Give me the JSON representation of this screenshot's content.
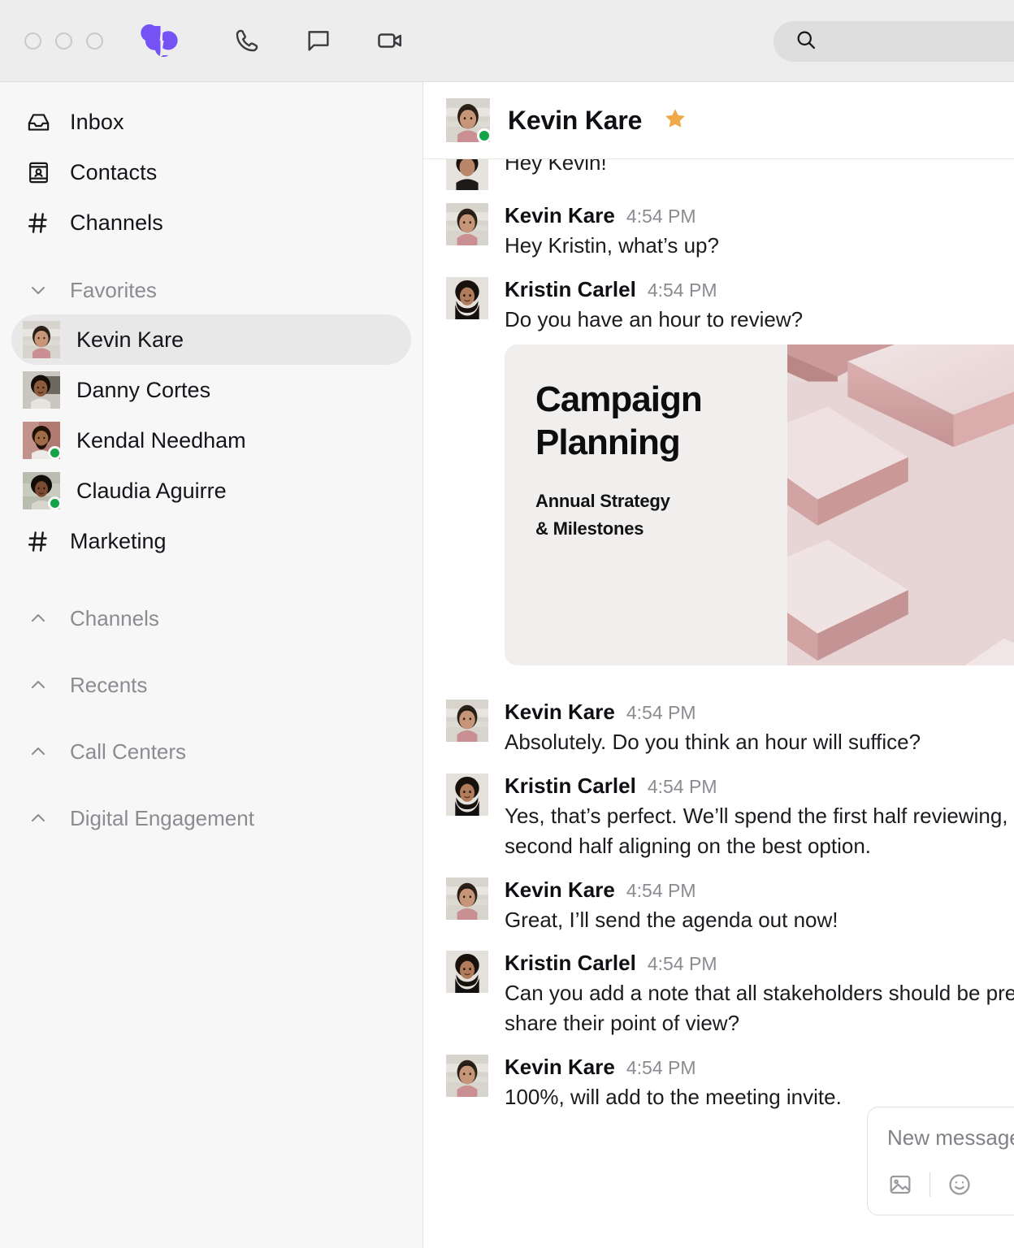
{
  "titlebar": {
    "window_controls": [
      "close",
      "minimize",
      "maximize"
    ],
    "logo_name": "dialpad-logo",
    "icons": [
      {
        "name": "phone-icon",
        "label": "Calls"
      },
      {
        "name": "chat-bubble-icon",
        "label": "Messages"
      },
      {
        "name": "video-camera-icon",
        "label": "Meetings"
      }
    ],
    "search": {
      "placeholder": "",
      "value": "",
      "icon": "search-icon"
    }
  },
  "sidebar": {
    "nav": [
      {
        "label": "Inbox",
        "icon": "inbox-icon"
      },
      {
        "label": "Contacts",
        "icon": "contacts-card-icon"
      },
      {
        "label": "Channels",
        "icon": "hash-icon"
      }
    ],
    "favorites": {
      "label": "Favorites",
      "expanded": true,
      "chevron": "chevron-down-icon",
      "items": [
        {
          "name": "Kevin Kare",
          "online": false,
          "selected": true
        },
        {
          "name": "Danny Cortes",
          "online": false,
          "selected": false
        },
        {
          "name": "Kendal Needham",
          "online": true,
          "selected": false
        },
        {
          "name": "Claudia Aguirre",
          "online": true,
          "selected": false
        }
      ],
      "channel": {
        "label": "Marketing",
        "icon": "hash-icon"
      }
    },
    "sections": [
      {
        "label": "Channels",
        "chevron": "chevron-up-icon",
        "expanded": false
      },
      {
        "label": "Recents",
        "chevron": "chevron-up-icon",
        "expanded": false
      },
      {
        "label": "Call Centers",
        "chevron": "chevron-up-icon",
        "expanded": false
      },
      {
        "label": "Digital Engagement",
        "chevron": "chevron-up-icon",
        "expanded": false
      }
    ]
  },
  "chat": {
    "header": {
      "title": "Kevin Kare",
      "starred": true,
      "star_icon": "star-icon",
      "online": true
    },
    "clipped_message": {
      "text": "Hey Kevin!"
    },
    "messages": [
      {
        "sender": "Kevin Kare",
        "time": "4:54 PM",
        "text": "Hey Kristin, what’s up?",
        "avatar": "kevin",
        "wrap": false
      },
      {
        "sender": "Kristin Carlel",
        "time": "4:54 PM",
        "text": "Do you have an hour to review?",
        "avatar": "kristin",
        "wrap": false,
        "attachment": true
      },
      {
        "sender": "Kevin Kare",
        "time": "4:54 PM",
        "text": "Absolutely. Do you think an hour will suffice?",
        "avatar": "kevin",
        "wrap": false
      },
      {
        "sender": "Kristin Carlel",
        "time": "4:54 PM",
        "text": "Yes, that’s perfect. We’ll spend the first half reviewing, and the second half aligning on the best option.",
        "avatar": "kristin",
        "wrap": true
      },
      {
        "sender": "Kevin Kare",
        "time": "4:54 PM",
        "text": "Great, I’ll send the agenda out now!",
        "avatar": "kevin",
        "wrap": false
      },
      {
        "sender": "Kristin Carlel",
        "time": "4:54 PM",
        "text": "Can you add a note that all stakeholders should be prepared to share their point of view?",
        "avatar": "kristin",
        "wrap": true
      },
      {
        "sender": "Kevin Kare",
        "time": "4:54 PM",
        "text": "100%, will add to the meeting invite.",
        "avatar": "kevin",
        "wrap": false
      }
    ],
    "attachment": {
      "title_line1": "Campaign",
      "title_line2": "Planning",
      "subtitle_line1": "Annual Strategy",
      "subtitle_line2": "& Milestones",
      "image_alt": "pink-3d-platforms"
    },
    "composer": {
      "placeholder": "New message",
      "value": "",
      "tools": [
        {
          "name": "image-attach-icon"
        },
        {
          "name": "emoji-icon"
        }
      ]
    }
  },
  "colors": {
    "brand_purple": "#7452F4",
    "online_green": "#15a349",
    "star_orange": "#EFA948",
    "titlebar_bg": "#ededed",
    "sidebar_bg": "#f7f7f7",
    "selected_pill": "#e8e8e8",
    "card_bg": "#f1efed"
  }
}
